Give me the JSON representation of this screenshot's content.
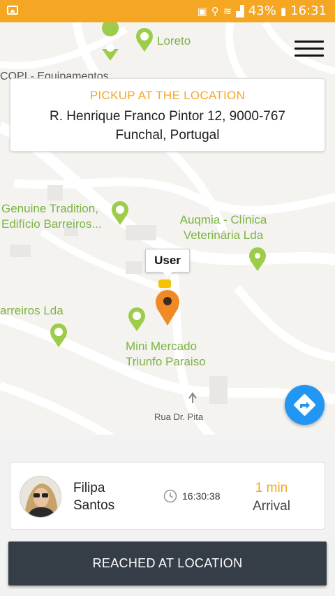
{
  "status_bar": {
    "battery": "43%",
    "time": "16:31"
  },
  "map": {
    "pois": [
      {
        "label": "Loreto"
      },
      {
        "label": "COPI - Equipamentos"
      },
      {
        "label": "Genuine Tradition, Edifício Barreiros..."
      },
      {
        "label": "Auqmia - Clínica Veterinária Lda"
      },
      {
        "label": "arreiros Lda"
      },
      {
        "label": "Mini Mercado Triunfo Paraiso"
      }
    ],
    "street": "Rua Dr. Pita",
    "marker_label": "User"
  },
  "pickup": {
    "title": "PICKUP AT THE LOCATION",
    "address": "R. Henrique Franco Pintor 12, 9000-767 Funchal, Portugal"
  },
  "driver": {
    "first_name": "Filipa",
    "last_name": "Santos",
    "time": "16:30:38",
    "eta_value": "1 min",
    "eta_label": "Arrival"
  },
  "action": {
    "reached_label": "REACHED AT LOCATION"
  },
  "colors": {
    "accent": "#f5a623",
    "status_bar": "#f5a623",
    "button": "#353d47",
    "fab": "#2196f3",
    "poi_green": "#7cb342"
  },
  "icons": [
    "image-icon",
    "signal-icon",
    "wifi-icon",
    "battery-icon",
    "menu-icon",
    "shopping-pin-icon",
    "location-pin-icon",
    "user-marker-icon",
    "directions-icon",
    "clock-icon"
  ]
}
